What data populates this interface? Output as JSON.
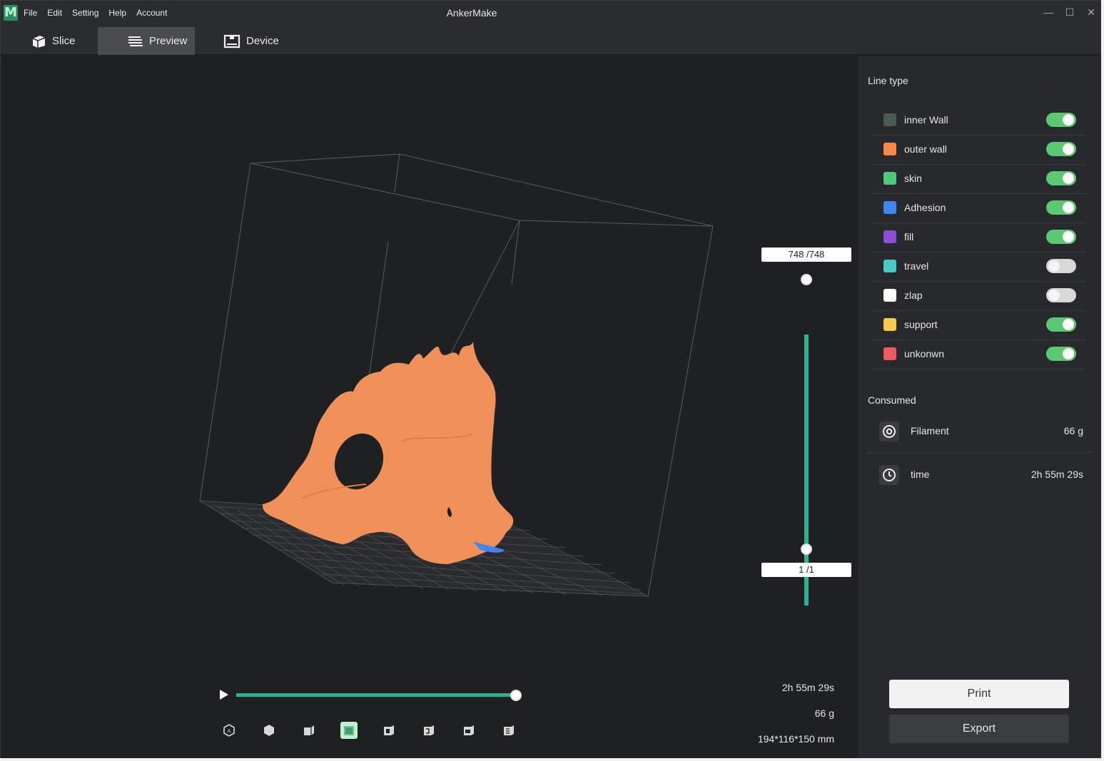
{
  "app": {
    "logo": "M",
    "title": "AnkerMake"
  },
  "menu": [
    "File",
    "Edit",
    "Setting",
    "Help",
    "Account"
  ],
  "window_controls": {
    "minimize": "—",
    "maximize": "☐",
    "close": "✕"
  },
  "tabs": [
    {
      "label": "Slice",
      "icon": "slice-cube-icon",
      "active": false
    },
    {
      "label": "Preview",
      "icon": "preview-layers-icon",
      "active": true
    },
    {
      "label": "Device",
      "icon": "device-printer-icon",
      "active": false
    }
  ],
  "viewport": {
    "layer_top_label": "748 /748",
    "layer_bottom_label": "1 /1",
    "progress": 1.0,
    "stats": {
      "time": "2h 55m 29s",
      "weight": "66 g",
      "dimensions": "194*116*150 mm"
    },
    "view_buttons": [
      "auto-view-icon",
      "iso-view-icon",
      "front-view-icon",
      "top-view-icon",
      "left-view-icon",
      "right-view-icon",
      "back-view-icon",
      "bottom-view-icon"
    ],
    "active_view": 3
  },
  "panel": {
    "line_type_title": "Line type",
    "line_types": [
      {
        "name": "inner Wall",
        "color": "#4a5a55",
        "on": true
      },
      {
        "name": "outer wall",
        "color": "#f5884a",
        "on": true
      },
      {
        "name": "skin",
        "color": "#4ec97a",
        "on": true
      },
      {
        "name": "Adhesion",
        "color": "#3f86f0",
        "on": true
      },
      {
        "name": "fill",
        "color": "#8b4fd6",
        "on": true
      },
      {
        "name": "travel",
        "color": "#4cc9c4",
        "on": false
      },
      {
        "name": "zlap",
        "color": "#ffffff",
        "on": false
      },
      {
        "name": "support",
        "color": "#f5c94a",
        "on": true
      },
      {
        "name": "unkonwn",
        "color": "#ef5a5f",
        "on": true
      }
    ],
    "consumed_title": "Consumed",
    "consumed": [
      {
        "label": "Filament",
        "value": "66 g",
        "icon": "filament-spool-icon"
      },
      {
        "label": "time",
        "value": "2h 55m 29s",
        "icon": "clock-icon"
      }
    ],
    "print_label": "Print",
    "export_label": "Export"
  },
  "colors": {
    "accent": "#2bb394",
    "toggle_on": "#5cc972",
    "model": "#f0915a"
  }
}
